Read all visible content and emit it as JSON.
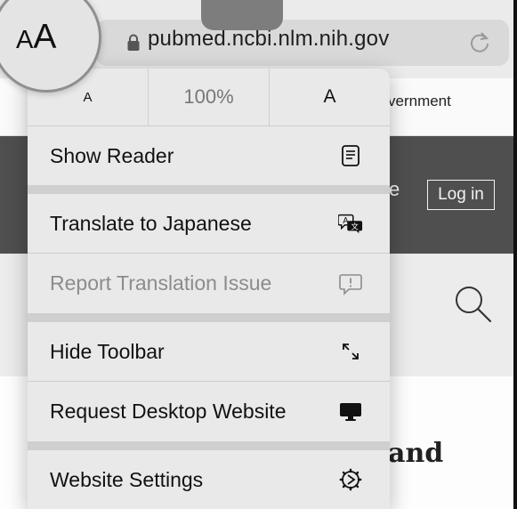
{
  "browser": {
    "url": "pubmed.ncbi.nlm.nih.gov",
    "format_button": {
      "small": "A",
      "large": "A",
      "combined": "aA"
    }
  },
  "page": {
    "gov_banner_fragment": "vernment",
    "header_fragment": "e",
    "login_label": "Log in",
    "article_fragment": "and"
  },
  "menu": {
    "zoom": {
      "decrease": "A",
      "level": "100%",
      "increase": "A"
    },
    "items": [
      {
        "label": "Show Reader",
        "icon": "reader-icon",
        "enabled": true
      },
      {
        "label": "Translate to Japanese",
        "icon": "translate-icon",
        "enabled": true
      },
      {
        "label": "Report Translation Issue",
        "icon": "report-issue-icon",
        "enabled": false
      },
      {
        "label": "Hide Toolbar",
        "icon": "hide-toolbar-icon",
        "enabled": true
      },
      {
        "label": "Request Desktop Website",
        "icon": "desktop-icon",
        "enabled": true
      },
      {
        "label": "Website Settings",
        "icon": "settings-icon",
        "enabled": true
      }
    ]
  },
  "colors": {
    "menu_background": "#e9e9e9",
    "header_dark": "#4f4f4f",
    "disabled_text": "#8c8c8c"
  }
}
